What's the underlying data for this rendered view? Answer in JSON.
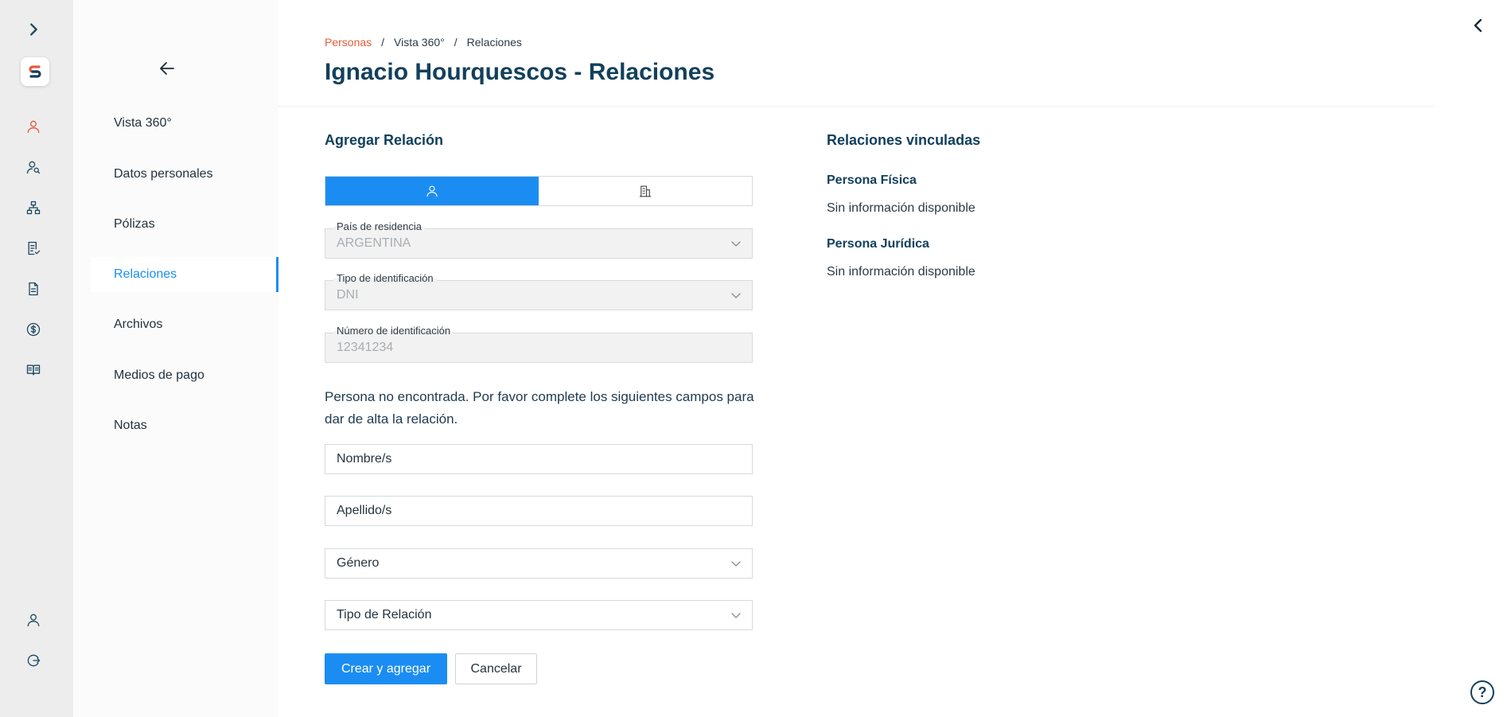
{
  "rail": {
    "icons": [
      "expand-chevron-icon",
      "app-logo",
      "person-icon",
      "persons-search-icon",
      "org-chart-icon",
      "checklist-icon",
      "document-icon",
      "dollar-icon",
      "book-icon",
      "user-account-icon",
      "logout-icon"
    ]
  },
  "subnav": {
    "back_icon": "arrow-left-icon",
    "items": [
      {
        "label": "Vista 360°"
      },
      {
        "label": "Datos personales"
      },
      {
        "label": "Pólizas"
      },
      {
        "label": "Relaciones",
        "active": true
      },
      {
        "label": "Archivos"
      },
      {
        "label": "Medios de pago"
      },
      {
        "label": "Notas"
      }
    ]
  },
  "breadcrumb": {
    "items": [
      "Personas",
      "Vista 360°",
      "Relaciones"
    ],
    "separator": "/"
  },
  "page_title": "Ignacio Hourquescos - Relaciones",
  "add_relation": {
    "title": "Agregar Relación",
    "toggle": {
      "selected": "persona-fisica",
      "options": [
        "person-icon",
        "building-icon"
      ]
    },
    "country": {
      "label": "País de residencia",
      "value": "ARGENTINA"
    },
    "id_type": {
      "label": "Tipo de identificación",
      "value": "DNI"
    },
    "id_number": {
      "label": "Número de identificación",
      "value": "12341234"
    },
    "notice": "Persona no encontrada. Por favor complete los siguientes campos para dar de alta la relación.",
    "first_name": {
      "placeholder": "Nombre/s"
    },
    "last_name": {
      "placeholder": "Apellido/s"
    },
    "gender": {
      "value": "Género"
    },
    "relation_type": {
      "value": "Tipo de Relación"
    },
    "submit_label": "Crear y agregar",
    "cancel_label": "Cancelar"
  },
  "linked": {
    "title": "Relaciones vinculadas",
    "fisica_title": "Persona Física",
    "fisica_empty": "Sin información disponible",
    "juridica_title": "Persona Jurídica",
    "juridica_empty": "Sin información disponible"
  },
  "help_label": "?",
  "colors": {
    "accent": "#1b8df2",
    "brand_red": "#e35a3a",
    "title": "#12405c"
  }
}
